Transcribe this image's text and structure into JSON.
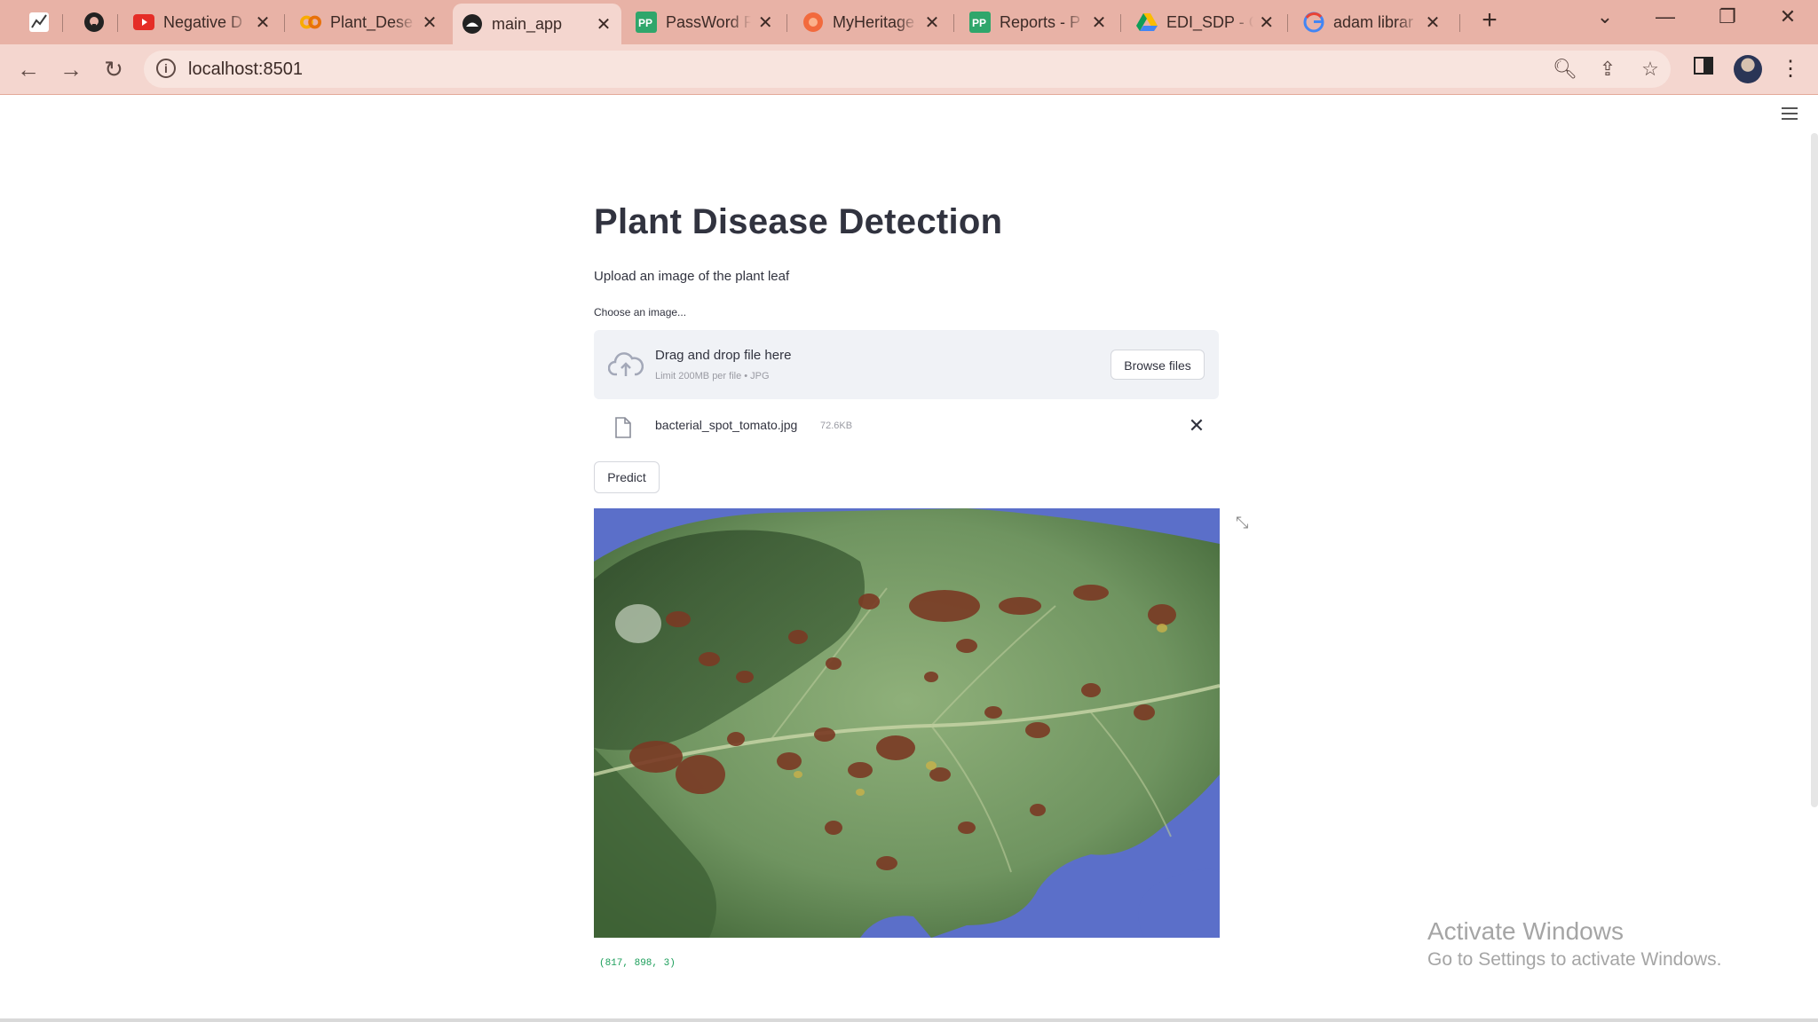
{
  "browser": {
    "tabs": [
      {
        "label": "",
        "icon": "stocks-chart-icon"
      },
      {
        "label": "",
        "icon": "github-icon"
      },
      {
        "label": "Negative D",
        "icon": "youtube-icon"
      },
      {
        "label": "Plant_Dese",
        "icon": "colab-icon"
      },
      {
        "label": "main_app",
        "icon": "streamlit-icon",
        "active": true
      },
      {
        "label": "PassWord F",
        "icon": "pp-icon"
      },
      {
        "label": "MyHeritage",
        "icon": "myheritage-icon"
      },
      {
        "label": "Reports - P",
        "icon": "pp-icon"
      },
      {
        "label": "EDI_SDP - C",
        "icon": "google-drive-icon"
      },
      {
        "label": "adam librar",
        "icon": "google-icon"
      }
    ],
    "url": "localhost:8501"
  },
  "app": {
    "title": "Plant Disease Detection",
    "subtitle": "Upload an image of the plant leaf",
    "uploader": {
      "label": "Choose an image...",
      "drag_text": "Drag and drop file here",
      "limit_text": "Limit 200MB per file • JPG",
      "browse_label": "Browse files"
    },
    "file": {
      "name": "bacterial_spot_tomato.jpg",
      "size": "72.6KB"
    },
    "predict_label": "Predict",
    "image_shape": "(817, 898, 3)"
  },
  "os_watermark": {
    "line1": "Activate Windows",
    "line2": "Go to Settings to activate Windows."
  },
  "colors": {
    "tabbar": "#e8b2a6",
    "toolbar": "#f4d6cf",
    "dropzone": "#f0f2f6",
    "shape_text": "#1b9e5a",
    "leaf_background": "#5b6fc9"
  }
}
